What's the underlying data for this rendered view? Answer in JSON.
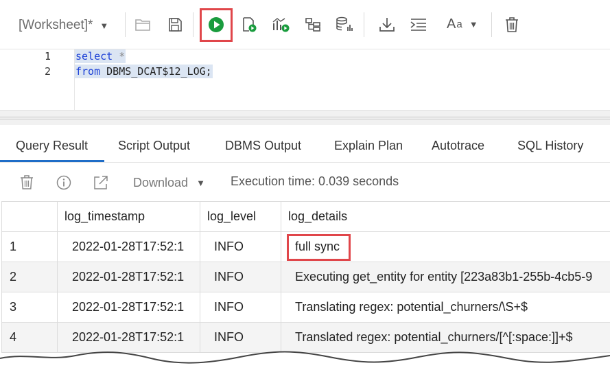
{
  "toolbar": {
    "worksheet_label": "[Worksheet]*",
    "worksheet_caret": "▼",
    "font_label_big": "A",
    "font_label_small": "a",
    "font_caret": "▼",
    "highlight_color": "#e0464a",
    "run_color": "#1a9c3e"
  },
  "editor": {
    "lines": [
      {
        "number": "1",
        "keyword": "select",
        "rest": " *"
      },
      {
        "number": "2",
        "keyword": "from",
        "rest": " DBMS_DCAT$12_LOG;"
      }
    ]
  },
  "tabs": [
    {
      "label": "Query Result",
      "active": true
    },
    {
      "label": "Script Output"
    },
    {
      "label": "DBMS Output"
    },
    {
      "label": "Explain Plan"
    },
    {
      "label": "Autotrace"
    },
    {
      "label": "SQL History"
    }
  ],
  "result_toolbar": {
    "download_label": "Download",
    "download_caret": "▼",
    "execution_time": "Execution time: 0.039 seconds"
  },
  "grid": {
    "columns": [
      "log_timestamp",
      "log_level",
      "log_details"
    ],
    "rows": [
      {
        "n": "1",
        "ts": "2022-01-28T17:52:1",
        "level": "INFO",
        "details": "full sync"
      },
      {
        "n": "2",
        "ts": "2022-01-28T17:52:1",
        "level": "INFO",
        "details": "Executing get_entity for entity [223a83b1-255b-4cb5-9"
      },
      {
        "n": "3",
        "ts": "2022-01-28T17:52:1",
        "level": "INFO",
        "details": "Translating regex: potential_churners/\\S+$"
      },
      {
        "n": "4",
        "ts": "2022-01-28T17:52:1",
        "level": "INFO",
        "details": "Translated regex: potential_churners/[^[:space:]]+$"
      }
    ]
  }
}
